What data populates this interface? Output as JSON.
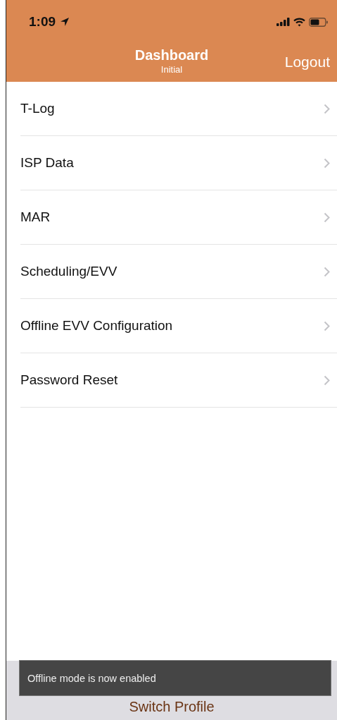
{
  "status_bar": {
    "time": "1:09"
  },
  "nav_bar": {
    "title": "Dashboard",
    "subtitle": "Initial",
    "right_button": "Logout"
  },
  "menu_items": [
    {
      "label": "T-Log"
    },
    {
      "label": "ISP Data"
    },
    {
      "label": "MAR"
    },
    {
      "label": "Scheduling/EVV"
    },
    {
      "label": "Offline EVV Configuration"
    },
    {
      "label": "Password Reset"
    }
  ],
  "bottom_bar": {
    "button": "Switch Profile"
  },
  "toast": {
    "message": "Offline mode is now enabled"
  }
}
